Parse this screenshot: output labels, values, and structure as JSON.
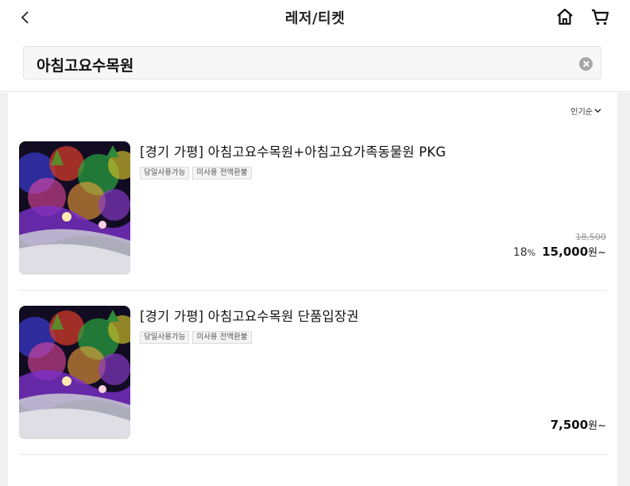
{
  "header": {
    "title": "레저/티켓"
  },
  "search": {
    "query": "아침고요수목원"
  },
  "sort": {
    "label": "인기순"
  },
  "products": [
    {
      "title": "[경기 가평] 아침고요수목원+아침고요가족동물원 PKG",
      "tags": [
        "당일사용가능",
        "미사용 전액환불"
      ],
      "original_price": "18,500",
      "discount": "18",
      "discount_unit": "%",
      "price": "15,000",
      "currency": "원~"
    },
    {
      "title": "[경기 가평] 아침고요수목원 단품입장권",
      "tags": [
        "당일사용가능",
        "미사용 전액환불"
      ],
      "price": "7,500",
      "currency": "원~"
    }
  ]
}
